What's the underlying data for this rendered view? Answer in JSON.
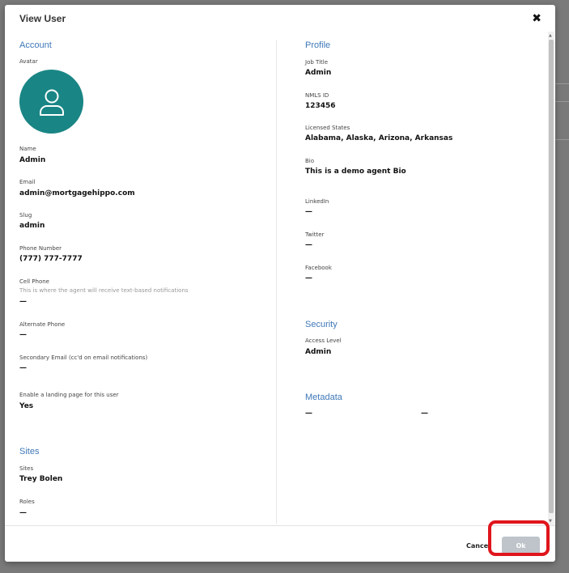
{
  "modal": {
    "title": "View User",
    "close_icon": "close-icon"
  },
  "account": {
    "title": "Account",
    "avatar_label": "Avatar",
    "avatar_icon": "user-icon",
    "avatar_color": "#1a8585",
    "name_label": "Name",
    "name_value": "Admin",
    "email_label": "Email",
    "email_value": "admin@mortgagehippo.com",
    "slug_label": "Slug",
    "slug_value": "admin",
    "phone_label": "Phone Number",
    "phone_value": "(777) 777-7777",
    "cell_label": "Cell Phone",
    "cell_help": "This is where the agent will receive text-based notifications",
    "cell_value": "—",
    "alt_phone_label": "Alternate Phone",
    "alt_phone_value": "—",
    "secondary_email_label": "Secondary Email (cc'd on email notifications)",
    "secondary_email_value": "—",
    "landing_label": "Enable a landing page for this user",
    "landing_value": "Yes"
  },
  "sites": {
    "title": "Sites",
    "sites_label": "Sites",
    "sites_value": "Trey Bolen",
    "roles_label": "Roles",
    "roles_value": "—"
  },
  "profile": {
    "title": "Profile",
    "job_title_label": "Job Title",
    "job_title_value": "Admin",
    "nmls_label": "NMLS ID",
    "nmls_value": "123456",
    "states_label": "Licensed States",
    "states_value": "Alabama, Alaska, Arizona, Arkansas",
    "bio_label": "Bio",
    "bio_value": "This is a demo agent Bio",
    "linkedin_label": "LinkedIn",
    "linkedin_value": "—",
    "twitter_label": "Twitter",
    "twitter_value": "—",
    "facebook_label": "Facebook",
    "facebook_value": "—"
  },
  "security": {
    "title": "Security",
    "access_label": "Access Level",
    "access_value": "Admin"
  },
  "metadata": {
    "title": "Metadata",
    "value_1": "—",
    "value_2": "—"
  },
  "footer": {
    "cancel_label": "Cancel",
    "ok_label": "Ok"
  },
  "colors": {
    "accent": "#3f78b8",
    "highlight": "#e0151c",
    "ok_disabled": "#bec4ca"
  }
}
